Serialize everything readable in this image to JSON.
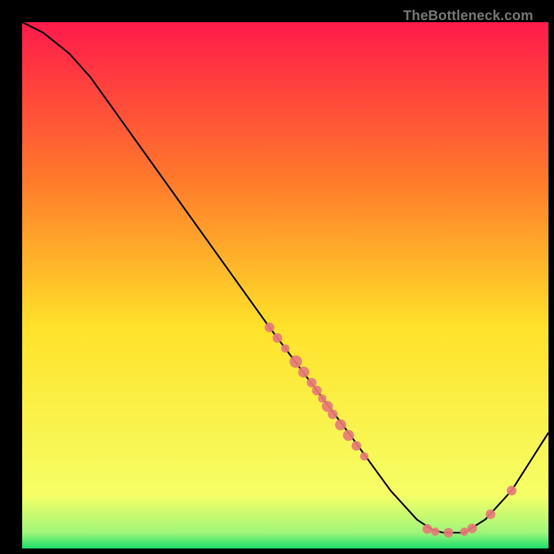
{
  "watermark": "TheBottleneck.com",
  "chart_data": {
    "type": "line",
    "title": "",
    "xlabel": "",
    "ylabel": "",
    "xlim": [
      0,
      100
    ],
    "ylim": [
      0,
      100
    ],
    "background_gradient": {
      "top": "#ff1a4b",
      "mid_top": "#ff7a2a",
      "mid": "#ffe22a",
      "low": "#f5ff66",
      "bottom": "#1adf6a"
    },
    "curve": [
      {
        "x": 0,
        "y": 100
      },
      {
        "x": 4,
        "y": 98
      },
      {
        "x": 9,
        "y": 94
      },
      {
        "x": 13,
        "y": 89.5
      },
      {
        "x": 47,
        "y": 42
      },
      {
        "x": 62,
        "y": 22
      },
      {
        "x": 70,
        "y": 11
      },
      {
        "x": 75,
        "y": 5.5
      },
      {
        "x": 78,
        "y": 3.5
      },
      {
        "x": 80,
        "y": 3
      },
      {
        "x": 84,
        "y": 3
      },
      {
        "x": 88,
        "y": 5.5
      },
      {
        "x": 93,
        "y": 11
      },
      {
        "x": 100,
        "y": 22
      }
    ],
    "marker_color": "#e77a78",
    "markers": [
      {
        "x": 47,
        "y": 42,
        "r": 7
      },
      {
        "x": 48.5,
        "y": 40,
        "r": 7
      },
      {
        "x": 50,
        "y": 38,
        "r": 6
      },
      {
        "x": 52,
        "y": 35.5,
        "r": 9
      },
      {
        "x": 53.5,
        "y": 33.5,
        "r": 8
      },
      {
        "x": 55,
        "y": 31.5,
        "r": 7
      },
      {
        "x": 56,
        "y": 30,
        "r": 7
      },
      {
        "x": 57,
        "y": 28.5,
        "r": 6
      },
      {
        "x": 58,
        "y": 27,
        "r": 8
      },
      {
        "x": 59,
        "y": 25.5,
        "r": 7
      },
      {
        "x": 60.5,
        "y": 23.5,
        "r": 8
      },
      {
        "x": 62,
        "y": 21.5,
        "r": 8
      },
      {
        "x": 63.5,
        "y": 19.5,
        "r": 7
      },
      {
        "x": 65,
        "y": 17.5,
        "r": 6
      },
      {
        "x": 77,
        "y": 3.7,
        "r": 7
      },
      {
        "x": 78.5,
        "y": 3.2,
        "r": 6
      },
      {
        "x": 81,
        "y": 3,
        "r": 7
      },
      {
        "x": 84,
        "y": 3.2,
        "r": 6
      },
      {
        "x": 85.5,
        "y": 3.8,
        "r": 7
      },
      {
        "x": 89,
        "y": 6.5,
        "r": 7
      },
      {
        "x": 93,
        "y": 11,
        "r": 7
      }
    ]
  }
}
